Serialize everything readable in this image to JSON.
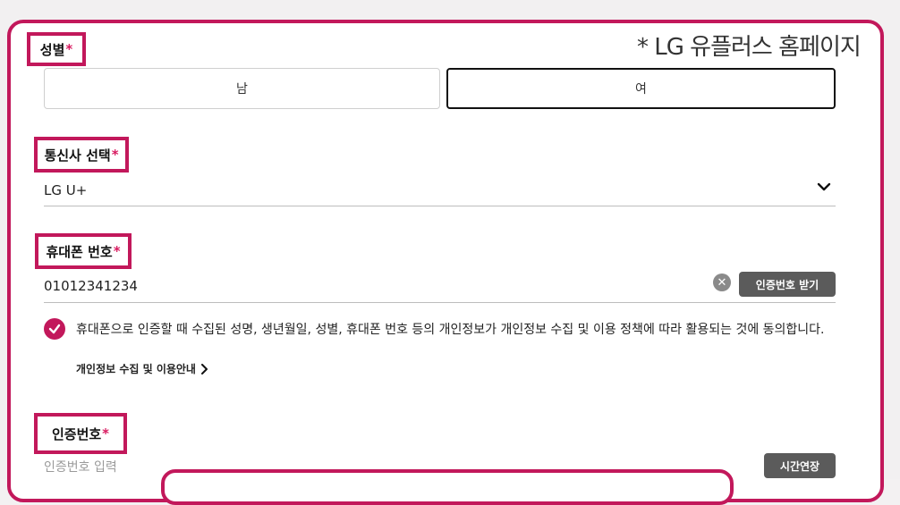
{
  "watermark": "* LG 유플러스 홈페이지",
  "gender": {
    "label": "성별",
    "required_mark": "*",
    "options": [
      "남",
      "여"
    ],
    "selected": "여"
  },
  "carrier": {
    "label": "통신사 선택",
    "required_mark": "*",
    "value": "LG U+"
  },
  "phone": {
    "label": "휴대폰 번호",
    "required_mark": "*",
    "value": "01012341234",
    "request_button": "인증번호 받기"
  },
  "consent": {
    "text": "휴대폰으로 인증할 때 수집된 성명, 생년월일, 성별, 휴대폰 번호 등의 개인정보가 개인정보 수집 및 이용 정책에 따라 활용되는 것에 동의합니다.",
    "link": "개인정보 수집 및 이용안내",
    "checked": true
  },
  "auth": {
    "label": "인증번호",
    "required_mark": "*",
    "placeholder": "인증번호 입력",
    "extend_button": "시간연장"
  },
  "colors": {
    "accent": "#c2185b",
    "button_gray": "#5b5b5b"
  }
}
